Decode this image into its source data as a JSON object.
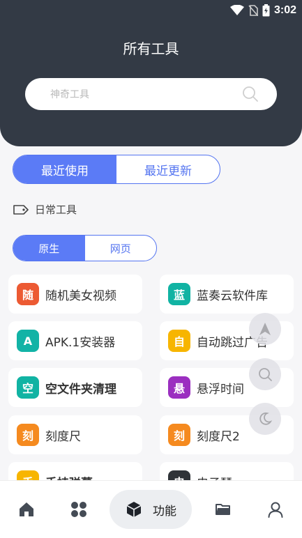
{
  "status_bar": {
    "time": "3:02"
  },
  "header": {
    "title": "所有工具"
  },
  "search": {
    "placeholder": "神奇工具"
  },
  "tabs": [
    {
      "label": "最近使用",
      "active": true
    },
    {
      "label": "最近更新",
      "active": false
    }
  ],
  "section": {
    "label": "日常工具"
  },
  "sub_tabs": [
    {
      "label": "原生",
      "active": true
    },
    {
      "label": "网页",
      "active": false
    }
  ],
  "tools": [
    {
      "icon_text": "随",
      "color": "#ec5a33",
      "name": "随机美女视频"
    },
    {
      "icon_text": "蓝",
      "color": "#11b3a3",
      "name": "蓝奏云软件库"
    },
    {
      "icon_text": "A",
      "color": "#12b3a6",
      "name": "APK.1安装器"
    },
    {
      "icon_text": "自",
      "color": "#f7b500",
      "name": "自动跳过广告"
    },
    {
      "icon_text": "空",
      "color": "#11b3a3",
      "name": "空文件夹清理"
    },
    {
      "icon_text": "悬",
      "color": "#9b2fc0",
      "name": "悬浮时间"
    },
    {
      "icon_text": "刻",
      "color": "#f58a1f",
      "name": "刻度尺"
    },
    {
      "icon_text": "刻",
      "color": "#f58a1f",
      "name": "刻度尺2"
    },
    {
      "icon_text": "手",
      "color": "#f7b500",
      "name": "手持弹幕"
    },
    {
      "icon_text": "电",
      "color": "#2f3338",
      "name": "电子琴"
    }
  ],
  "nav": {
    "active_label": "功能"
  },
  "colors": {
    "header": "#333a45",
    "accent": "#5b7bf6",
    "background": "#f6f6f8"
  }
}
